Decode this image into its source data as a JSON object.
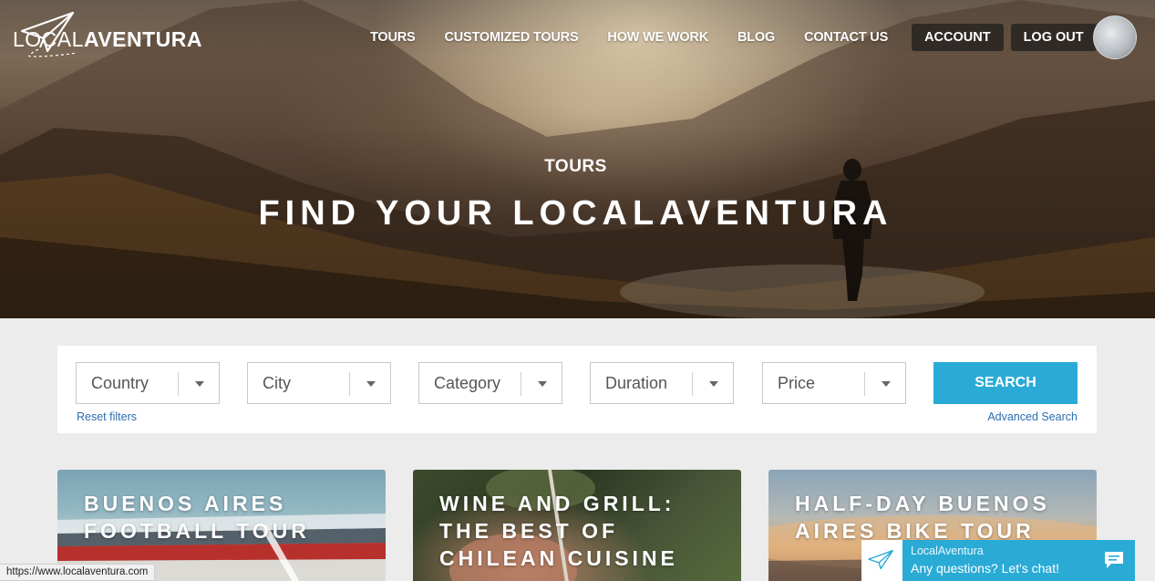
{
  "logo": {
    "text_light": "LOCAL",
    "text_bold": "AVENTURA",
    "icon": "paper-plane-icon"
  },
  "nav": {
    "links": [
      "TOURS",
      "CUSTOMIZED TOURS",
      "HOW WE WORK",
      "BLOG",
      "CONTACT US"
    ],
    "account": "ACCOUNT",
    "logout": "LOG OUT"
  },
  "hero": {
    "subtitle": "TOURS",
    "title": "FIND YOUR LOCALAVENTURA"
  },
  "filters": {
    "country": "Country",
    "city": "City",
    "category": "Category",
    "duration": "Duration",
    "price": "Price",
    "search": "SEARCH",
    "reset": "Reset filters",
    "advanced": "Advanced Search"
  },
  "cards": [
    {
      "title_line1": "BUENOS AIRES",
      "title_line2": "FOOTBALL TOUR",
      "title_line3": ""
    },
    {
      "title_line1": "WINE AND GRILL:",
      "title_line2": "THE BEST OF",
      "title_line3": "CHILEAN CUISINE"
    },
    {
      "title_line1": "HALF-DAY BUENOS",
      "title_line2": "AIRES BIKE TOUR",
      "title_line3": ""
    }
  ],
  "status_bar": {
    "url": "https://www.localaventura.com"
  },
  "chat": {
    "name": "LocalAventura",
    "message": "Any questions? Let's chat!",
    "icon": "chat-bubble-icon"
  },
  "colors": {
    "accent": "#29abd6",
    "nav_button_bg": "#2f2a26",
    "link": "#2a6db0"
  }
}
